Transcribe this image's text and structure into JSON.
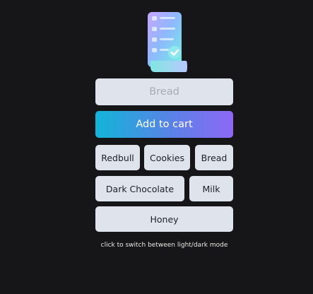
{
  "logo": {
    "icon": "shopping-list-icon"
  },
  "search": {
    "placeholder": "Bread",
    "value": ""
  },
  "add_button": {
    "label": "Add to cart"
  },
  "items": [
    "Redbull",
    "Cookies",
    "Bread",
    "Dark Chocolate",
    "Milk",
    "Honey"
  ],
  "footer": {
    "theme_hint": "click to switch between light/dark mode"
  },
  "colors": {
    "background": "#161618",
    "chip": "#dfe3ec",
    "gradient_start": "#12b5d8",
    "gradient_end": "#8d68f5"
  }
}
